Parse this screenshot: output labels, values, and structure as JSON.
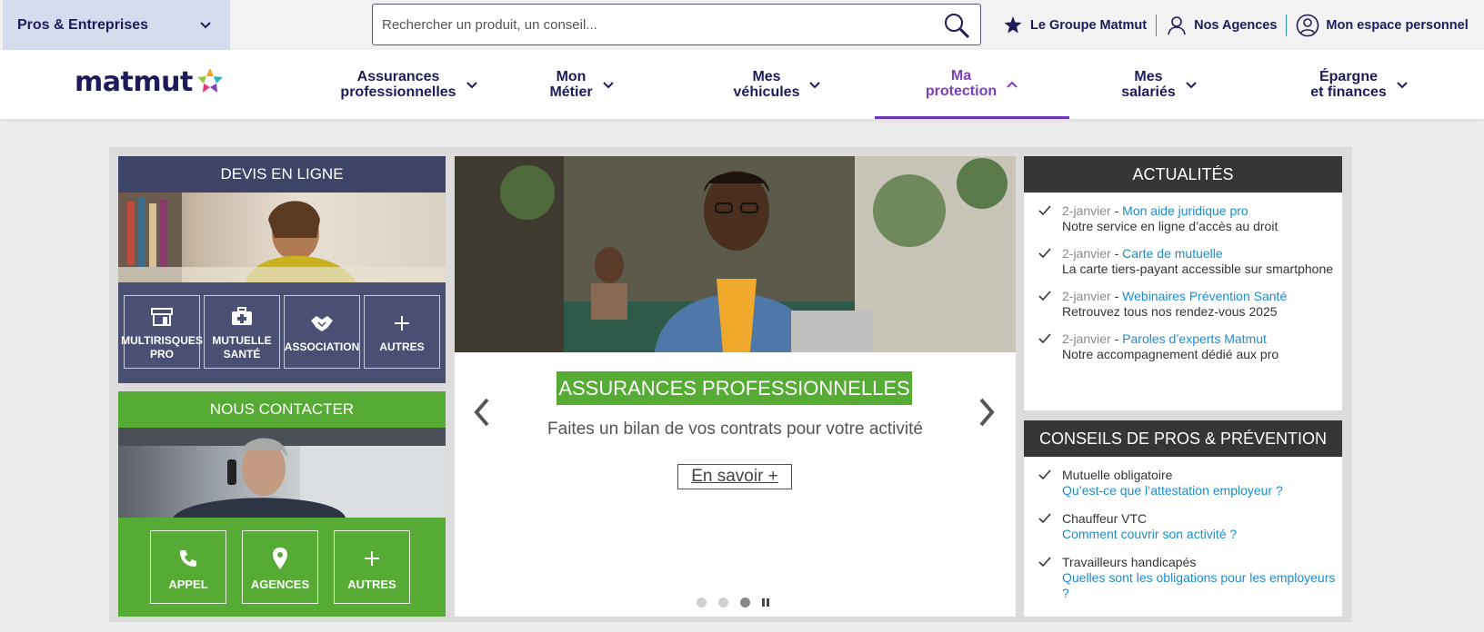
{
  "topbar": {
    "segment_label": "Pros & Entreprises",
    "search_placeholder": "Rechercher un produit, un conseil...",
    "links": [
      "Le Groupe Matmut",
      "Nos Agences",
      "Mon espace personnel"
    ]
  },
  "brand": {
    "logo_text": "matmut"
  },
  "nav": {
    "items": [
      {
        "line1": "Assurances",
        "line2": "professionnelles"
      },
      {
        "line1": "Mon",
        "line2": "Métier"
      },
      {
        "line1": "Mes",
        "line2": "véhicules"
      },
      {
        "line1": "Ma",
        "line2": "protection"
      },
      {
        "line1": "Mes",
        "line2": "salariés"
      },
      {
        "line1": "Épargne",
        "line2": "et finances"
      }
    ]
  },
  "devis": {
    "title": "DEVIS EN LIGNE",
    "tiles": [
      {
        "line1": "MULTIRISQUES",
        "line2": "PRO",
        "icon": "shop-icon"
      },
      {
        "line1": "MUTUELLE",
        "line2": "SANTÉ",
        "icon": "medical-kit-icon"
      },
      {
        "line1": "ASSOCIATION",
        "line2": "",
        "icon": "handshake-icon"
      },
      {
        "line1": "AUTRES",
        "line2": "",
        "icon": "plus-icon"
      }
    ]
  },
  "contact": {
    "title": "NOUS CONTACTER",
    "tiles": [
      {
        "label": "APPEL",
        "icon": "phone-icon"
      },
      {
        "label": "AGENCES",
        "icon": "location-pin-icon"
      },
      {
        "label": "AUTRES",
        "icon": "plus-icon"
      }
    ]
  },
  "carousel": {
    "title": "ASSURANCES PROFESSIONNELLES",
    "subtitle": "Faites un bilan de vos contrats pour votre activité",
    "cta": "En savoir +",
    "slide_count": 3,
    "active_slide": 3
  },
  "news": {
    "title": "ACTUALITÉS",
    "items": [
      {
        "date": "2-janvier",
        "link": "Mon aide juridique pro",
        "desc": "Notre service en ligne d’accès au droit"
      },
      {
        "date": "2-janvier",
        "link": "Carte de mutuelle",
        "desc": "La carte tiers-payant accessible sur smartphone"
      },
      {
        "date": "2-janvier",
        "link": "Webinaires Prévention Santé",
        "desc": "Retrouvez tous nos rendez-vous 2025"
      },
      {
        "date": "2-janvier",
        "link": "Paroles d’experts Matmut",
        "desc": "Notre accompagnement dédié aux pro"
      }
    ]
  },
  "conseils": {
    "title": "CONSEILS DE PROS & PRÉVENTION",
    "items": [
      {
        "topic": "Mutuelle obligatoire",
        "link": "Qu’est-ce que l’attestation employeur ?"
      },
      {
        "topic": "Chauffeur VTC",
        "link": "Comment couvrir son activité ?"
      },
      {
        "topic": "Travailleurs handicapés",
        "link": "Quelles sont les obligations pour les employeurs ?"
      }
    ]
  },
  "colors": {
    "brand_navy": "#1e1b5a",
    "accent_purple": "#6a35b8",
    "green": "#55ab34",
    "devis_panel": "#4a5074",
    "link_blue": "#1e8ccc"
  }
}
